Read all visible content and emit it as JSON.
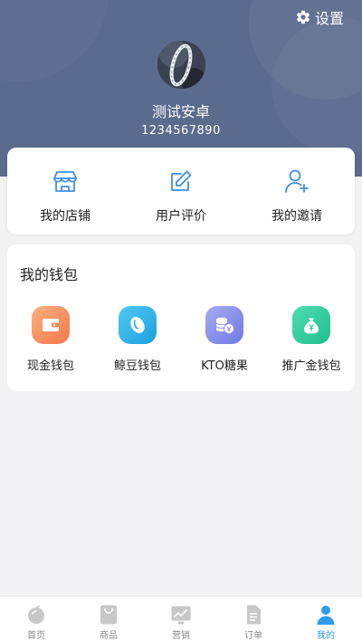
{
  "header": {
    "settings_label": "设置",
    "settings_icon": "gear-icon",
    "username": "测试安卓",
    "user_id": "1234567890",
    "background_color": "#5b6b8e"
  },
  "shop_menu": [
    {
      "label": "我的店铺",
      "icon": "store-icon"
    },
    {
      "label": "用户评价",
      "icon": "edit-icon"
    },
    {
      "label": "我的邀请",
      "icon": "add-user-icon"
    }
  ],
  "wallet": {
    "title": "我的钱包",
    "items": [
      {
        "label": "现金钱包",
        "icon": "cash-wallet-icon",
        "color": "#f88c5e"
      },
      {
        "label": "鲸豆钱包",
        "icon": "bean-icon",
        "color": "#2fb8e8"
      },
      {
        "label": "KTO糖果",
        "icon": "coins-icon",
        "color": "#8a93ee"
      },
      {
        "label": "推广金钱包",
        "icon": "money-bag-icon",
        "color": "#2fcf9c"
      }
    ]
  },
  "tabbar": {
    "active": "我的",
    "items": [
      {
        "label": "首页",
        "icon": "home-icon"
      },
      {
        "label": "商品",
        "icon": "product-bag-icon"
      },
      {
        "label": "营销",
        "icon": "marketing-chart-icon"
      },
      {
        "label": "订单",
        "icon": "order-doc-icon"
      },
      {
        "label": "我的",
        "icon": "profile-icon"
      }
    ]
  },
  "colors": {
    "accent": "#2f9bf0",
    "icon_blue": "#3d8ee8",
    "tab_inactive": "#c8c8c8"
  }
}
